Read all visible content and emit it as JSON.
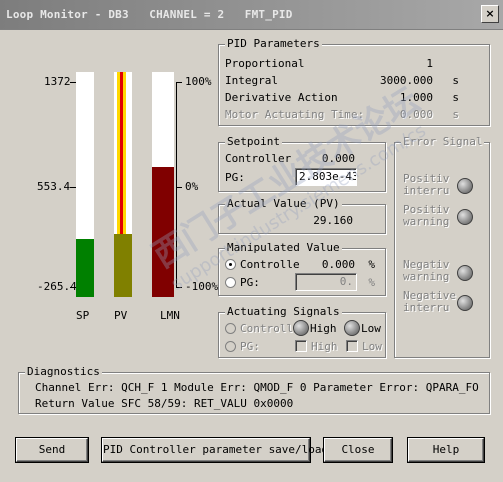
{
  "window": {
    "title": "Loop Monitor - DB3   CHANNEL = 2   FMT_PID",
    "close_label": "×"
  },
  "meters": {
    "scale_left": [
      "1372",
      "553.4",
      "-265.4"
    ],
    "scale_right": [
      "100%",
      "0%",
      "-100%"
    ],
    "labels": {
      "sp": "SP",
      "pv": "PV",
      "lmn": "LMN"
    },
    "sp_fill_fraction": 0.26,
    "pv_fill_fraction": 0.28,
    "lmn_fill_fraction": 0.58,
    "colors": {
      "sp": "#008000",
      "pv": "#808000",
      "lmn": "#800000",
      "pv_stripe_red": "#e00000",
      "pv_stripe_yellow": "#ffd800"
    }
  },
  "pid_parameters": {
    "title": "PID Parameters",
    "rows": [
      {
        "label": "Proportional",
        "value": "1",
        "unit": ""
      },
      {
        "label": "Integral",
        "value": "3000.000",
        "unit": "s"
      },
      {
        "label": "Derivative Action",
        "value": "1.000",
        "unit": "s"
      },
      {
        "label": "Motor Actuating Time:",
        "value": "0.000",
        "unit": "s"
      }
    ]
  },
  "setpoint": {
    "title": "Setpoint",
    "controller_label": "Controller",
    "controller_value": "0.000",
    "pg_label": "PG:",
    "pg_value": "2.803e-43"
  },
  "actual_value": {
    "title": "Actual Value (PV)",
    "value": "29.160"
  },
  "manipulated_value": {
    "title": "Manipulated Value",
    "controller_label": "Controlle",
    "controller_value": "0.000",
    "controller_unit": "%",
    "pg_label": "PG:",
    "pg_value": "0.",
    "pg_unit": "%"
  },
  "actuating_signals": {
    "title": "Actuating Signals",
    "controller_label": "Controll",
    "high_label": "High",
    "low_label": "Low",
    "pg_label": "PG:",
    "pg_high_label": "High",
    "pg_low_label": "Low"
  },
  "error_signal": {
    "title": "Error Signal",
    "items": [
      "Positiv interru",
      "Positiv warning",
      "Negativ warning",
      "Negative interru"
    ]
  },
  "diagnostics": {
    "title": "Diagnostics",
    "line1": "Channel Err: QCH_F 1  Module Err: QMOD_F  0  Parameter Error: QPARA_FO",
    "line2": "Return Value SFC 58/59: RET_VALU  0x0000"
  },
  "buttons": {
    "send": "Send",
    "save_load": "PID Controller parameter save/load",
    "close": "Close",
    "help": "Help"
  },
  "watermark": {
    "main": "西门子工业技术论坛",
    "sub": "support.industry.siemens.com/cs"
  }
}
